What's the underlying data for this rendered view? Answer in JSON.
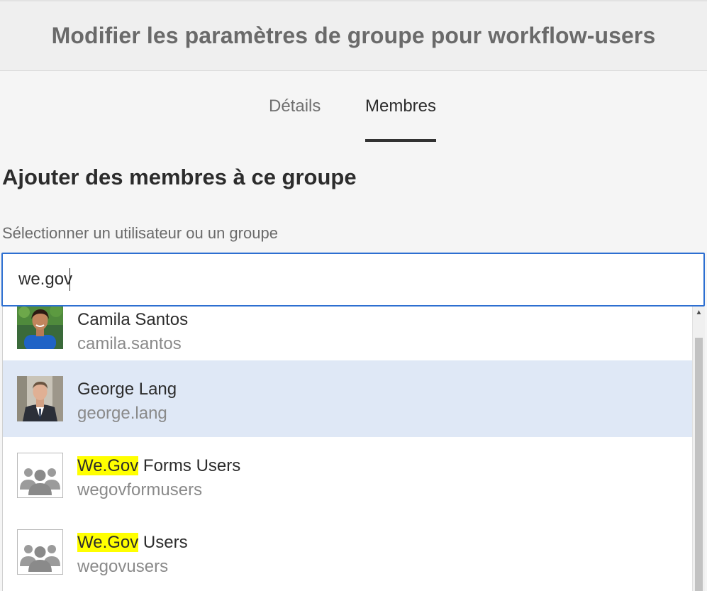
{
  "header": {
    "title": "Modifier les paramètres de groupe pour workflow-users"
  },
  "tabs": [
    {
      "label": "Détails",
      "active": false
    },
    {
      "label": "Membres",
      "active": true
    }
  ],
  "section": {
    "title": "Ajouter des membres à ce groupe",
    "field_label": "Sélectionner un utilisateur ou un groupe"
  },
  "search": {
    "value": "we.gov"
  },
  "results": [
    {
      "name": "Camila Santos",
      "id": "camila.santos",
      "avatar": "user-photo-camila",
      "selected": false
    },
    {
      "name": "George Lang",
      "id": "george.lang",
      "avatar": "user-photo-george",
      "selected": true
    },
    {
      "name_highlight": "We.Gov",
      "name_rest": " Forms Users",
      "id": "wegovformusers",
      "avatar": "group-icon",
      "selected": false
    },
    {
      "name_highlight": "We.Gov",
      "name_rest": " Users",
      "id": "wegovusers",
      "avatar": "group-icon",
      "selected": false
    }
  ],
  "colors": {
    "accent": "#2d6fd1",
    "selected_row": "#dfe8f6",
    "highlight": "#ffff00"
  }
}
